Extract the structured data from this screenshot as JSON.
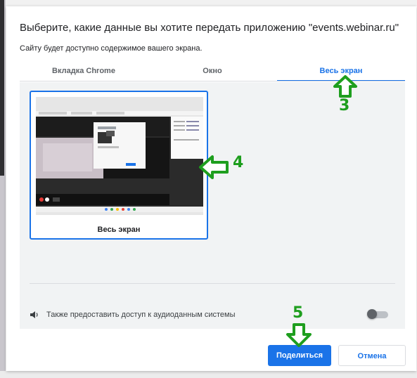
{
  "dialog": {
    "title": "Выберите, какие данные вы хотите передать приложению \"events.webinar.ru\"",
    "subtitle": "Сайту будет доступно содержимое вашего экрана."
  },
  "tabs": [
    {
      "label": "Вкладка Chrome",
      "active": false
    },
    {
      "label": "Окно",
      "active": false
    },
    {
      "label": "Весь экран",
      "active": true
    }
  ],
  "screen_option": {
    "label": "Весь экран"
  },
  "audio": {
    "label": "Также предоставить доступ к аудиоданным системы",
    "enabled": false
  },
  "buttons": {
    "share": "Поделиться",
    "cancel": "Отмена"
  },
  "annotations": [
    {
      "number": "3",
      "arrow": "up"
    },
    {
      "number": "4",
      "arrow": "left"
    },
    {
      "number": "5",
      "arrow": "down"
    }
  ],
  "colors": {
    "accent": "#1a73e8",
    "annotation": "#1e9e1e",
    "panel": "#f1f3f4"
  },
  "icons": [
    "speaker-icon",
    "arrow-up-icon",
    "arrow-left-icon",
    "arrow-down-icon"
  ]
}
